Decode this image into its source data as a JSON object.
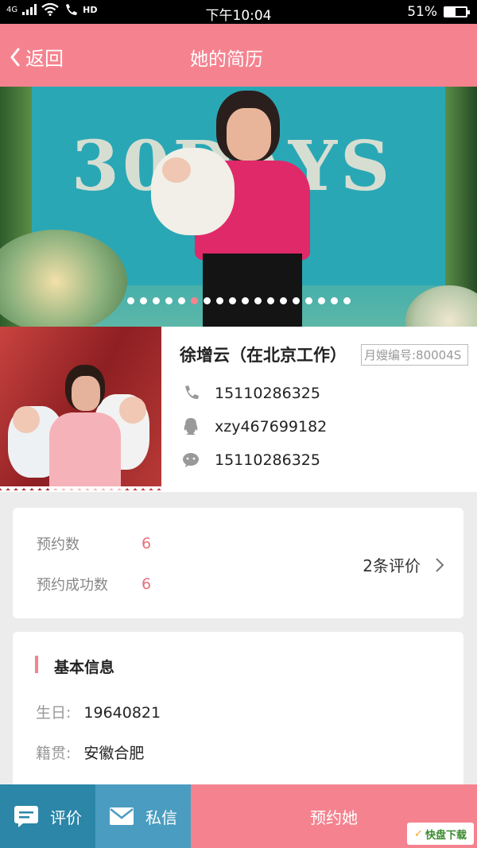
{
  "status_bar": {
    "network": "4G",
    "hd": "HD",
    "time": "下午10:04",
    "battery": "51%",
    "battery_level": 0.51
  },
  "nav": {
    "back_label": "返回",
    "title": "她的简历"
  },
  "banner": {
    "decor_text": "30DAYS",
    "slide_count": 18,
    "active_slide": 5
  },
  "profile": {
    "name": "徐增云（在北京工作）",
    "id_label": "月嫂编号:80004S",
    "phone": "15110286325",
    "qq": "xzy467699182",
    "wechat": "15110286325"
  },
  "stats": {
    "bookings_label": "预约数",
    "bookings_value": "6",
    "success_label": "预约成功数",
    "success_value": "6",
    "reviews_label": "2条评价"
  },
  "basic_info": {
    "title": "基本信息",
    "birthday_label": "生日:",
    "birthday_value": "19640821",
    "origin_label": "籍贯:",
    "origin_value": "安徽合肥"
  },
  "bottom_bar": {
    "review_label": "评价",
    "message_label": "私信",
    "book_label": "预约她"
  },
  "watermark": {
    "brand": "快盘下载"
  },
  "colors": {
    "accent": "#f5838f",
    "review_btn": "#2b86a8",
    "message_btn": "#4a9dc0"
  }
}
